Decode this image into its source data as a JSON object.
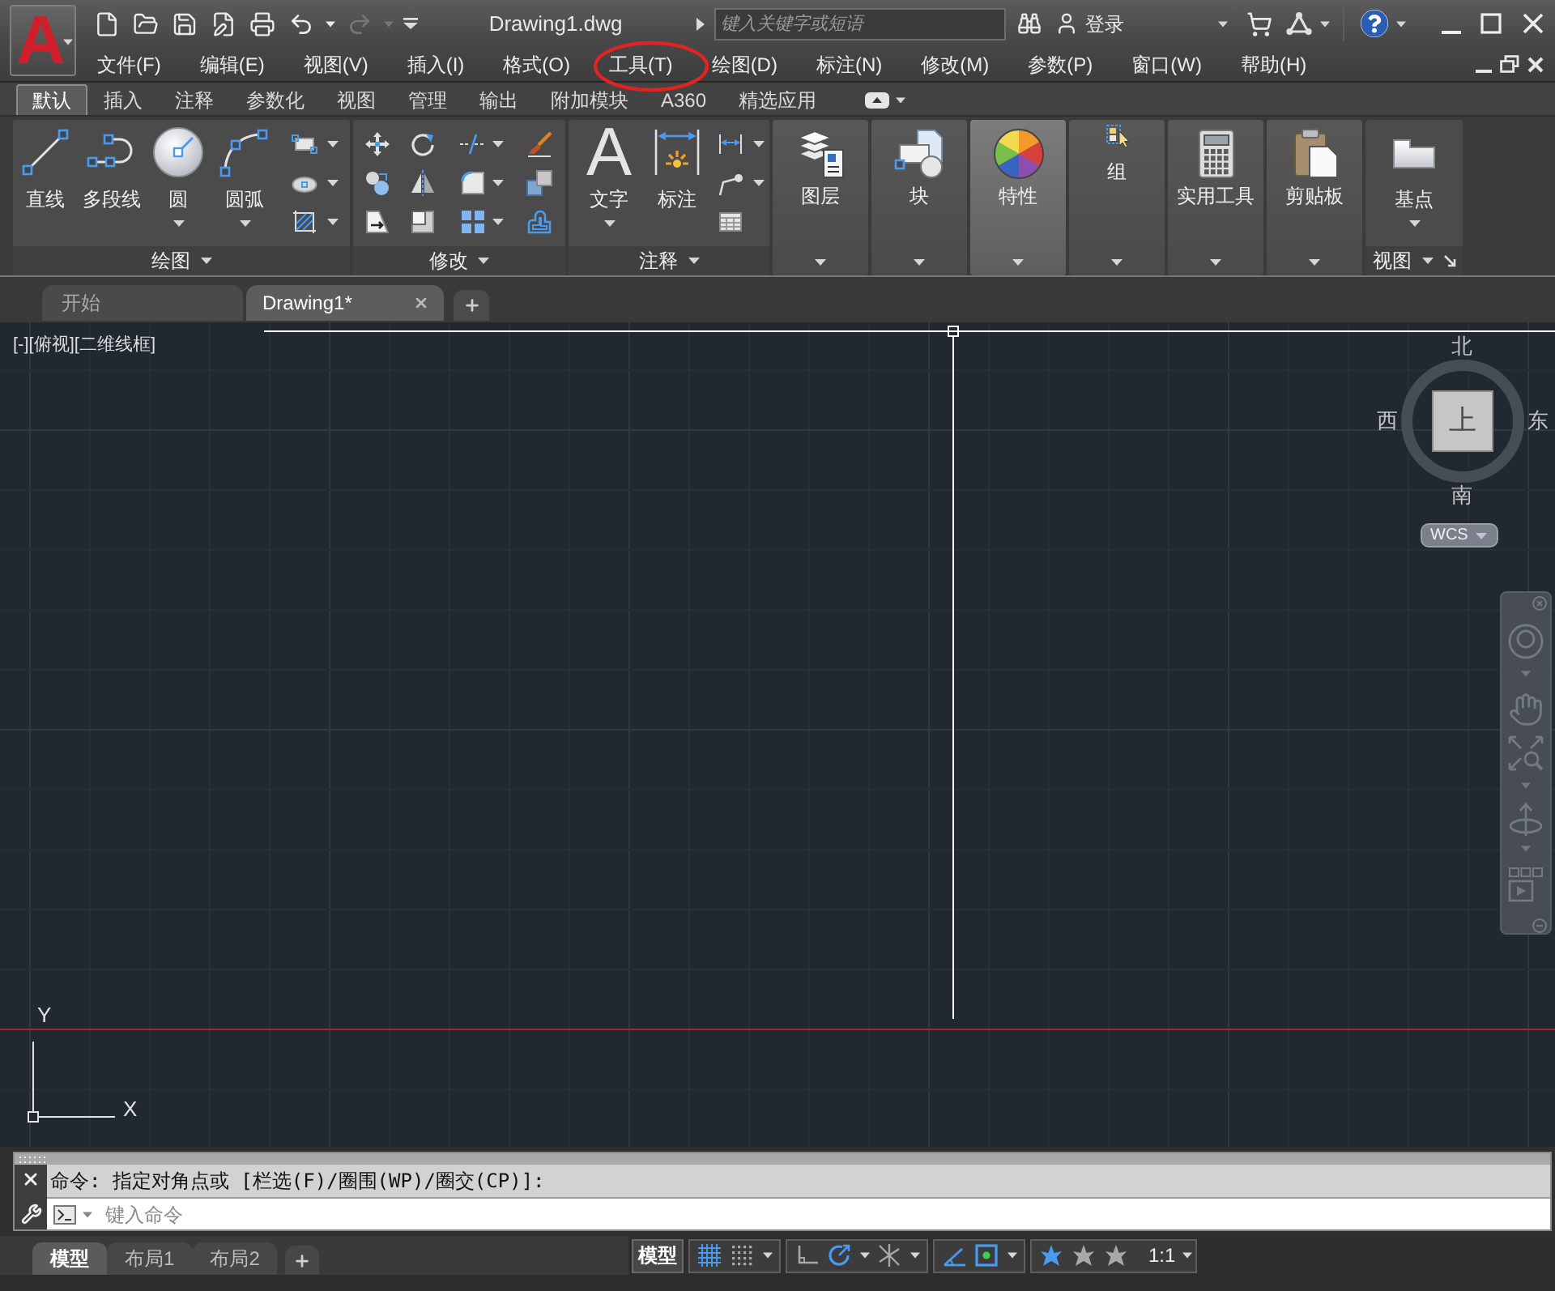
{
  "app_button": {
    "logo": "A"
  },
  "quick_access": [
    {
      "kind": "new",
      "disabled": false,
      "dropdown": false
    },
    {
      "kind": "open",
      "disabled": false,
      "dropdown": false
    },
    {
      "kind": "save",
      "disabled": false,
      "dropdown": false
    },
    {
      "kind": "save_as",
      "disabled": false,
      "dropdown": false
    },
    {
      "kind": "plot",
      "disabled": false,
      "dropdown": false
    },
    {
      "kind": "undo",
      "disabled": false,
      "dropdown": true
    },
    {
      "kind": "redo",
      "disabled": true,
      "dropdown": true
    }
  ],
  "window": {
    "title": "Drawing1.dwg"
  },
  "search": {
    "placeholder": "键入关键字或短语"
  },
  "account": {
    "label": "登录"
  },
  "menu": [
    "文件(F)",
    "编辑(E)",
    "视图(V)",
    "插入(I)",
    "格式(O)",
    "工具(T)",
    "绘图(D)",
    "标注(N)",
    "修改(M)",
    "参数(P)",
    "窗口(W)",
    "帮助(H)"
  ],
  "ribbon_tabs": [
    {
      "label": "默认",
      "selected": true
    },
    {
      "label": "插入",
      "selected": false
    },
    {
      "label": "注释",
      "selected": false
    },
    {
      "label": "参数化",
      "selected": false
    },
    {
      "label": "视图",
      "selected": false
    },
    {
      "label": "管理",
      "selected": false
    },
    {
      "label": "输出",
      "selected": false
    },
    {
      "label": "附加模块",
      "selected": false
    },
    {
      "label": "A360",
      "selected": false
    },
    {
      "label": "精选应用",
      "selected": false
    }
  ],
  "ribbon_panels": [
    {
      "kind": "draw",
      "title": "绘图",
      "highlighted": false,
      "buttons": [
        {
          "kind": "line",
          "label": "直线",
          "dropdown": false
        },
        {
          "kind": "polyline",
          "label": "多段线",
          "dropdown": false
        },
        {
          "kind": "circle",
          "label": "圆",
          "dropdown": true
        },
        {
          "kind": "arc",
          "label": "圆弧",
          "dropdown": true
        }
      ]
    },
    {
      "kind": "modify",
      "title": "修改",
      "highlighted": false
    },
    {
      "kind": "annotation",
      "title": "注释",
      "highlighted": false,
      "buttons": [
        {
          "kind": "text",
          "glyph": "A",
          "label": "文字",
          "dropdown": true
        },
        {
          "kind": "dimension",
          "label": "标注",
          "dropdown": false
        }
      ]
    },
    {
      "kind": "layers",
      "label": "图层",
      "highlighted": false
    },
    {
      "kind": "block",
      "label": "块",
      "highlighted": false
    },
    {
      "kind": "properties",
      "label": "特性",
      "highlighted": true
    },
    {
      "kind": "group",
      "label": "组",
      "highlighted": false
    },
    {
      "kind": "utilities",
      "label": "实用工具",
      "highlighted": false
    },
    {
      "kind": "clipboard",
      "label": "剪贴板",
      "highlighted": false
    },
    {
      "kind": "view",
      "title": "视图",
      "highlighted": false,
      "buttons": [
        {
          "kind": "base_point",
          "label": "基点",
          "dropdown": true
        }
      ]
    }
  ],
  "file_tabs": [
    {
      "label": "开始",
      "selected": false,
      "closable": false
    },
    {
      "label": "Drawing1*",
      "selected": true,
      "closable": true
    }
  ],
  "viewport_controls": [
    "[-]",
    "[俯视]",
    "[二维线框]"
  ],
  "viewcube": {
    "north": "北",
    "west": "西",
    "face": "上",
    "east": "东",
    "south": "南",
    "wcs": "WCS"
  },
  "ucs": {
    "y_label": "Y",
    "x_label": "X"
  },
  "command_line": {
    "history": "命令: 指定对角点或 [栏选(F)/圈围(WP)/圈交(CP)]:",
    "placeholder": "键入命令"
  },
  "layout_tabs": [
    {
      "label": "模型",
      "selected": true
    },
    {
      "label": "布局1",
      "selected": false
    },
    {
      "label": "布局2",
      "selected": false
    }
  ],
  "status_bar": {
    "model_button": "模型",
    "groups": [
      [
        {
          "kind": "grid",
          "on": true,
          "dropdown": false
        },
        {
          "kind": "snap",
          "on": false,
          "dropdown": true
        }
      ],
      [
        {
          "kind": "ortho",
          "on": false,
          "dropdown": false
        },
        {
          "kind": "polar",
          "on": true,
          "dropdown": true
        },
        {
          "kind": "isodraft",
          "on": false,
          "dropdown": true
        }
      ],
      [
        {
          "kind": "tracking",
          "on": true,
          "dropdown": false
        },
        {
          "kind": "osnap",
          "on": true,
          "dropdown": true
        }
      ],
      [
        {
          "kind": "annotation_visibility",
          "on": true,
          "dropdown": false
        },
        {
          "kind": "autoscale",
          "on": false,
          "dropdown": false
        },
        {
          "kind": "annotation_scale",
          "on": false,
          "dropdown": false
        }
      ]
    ],
    "scale": "1:1"
  }
}
